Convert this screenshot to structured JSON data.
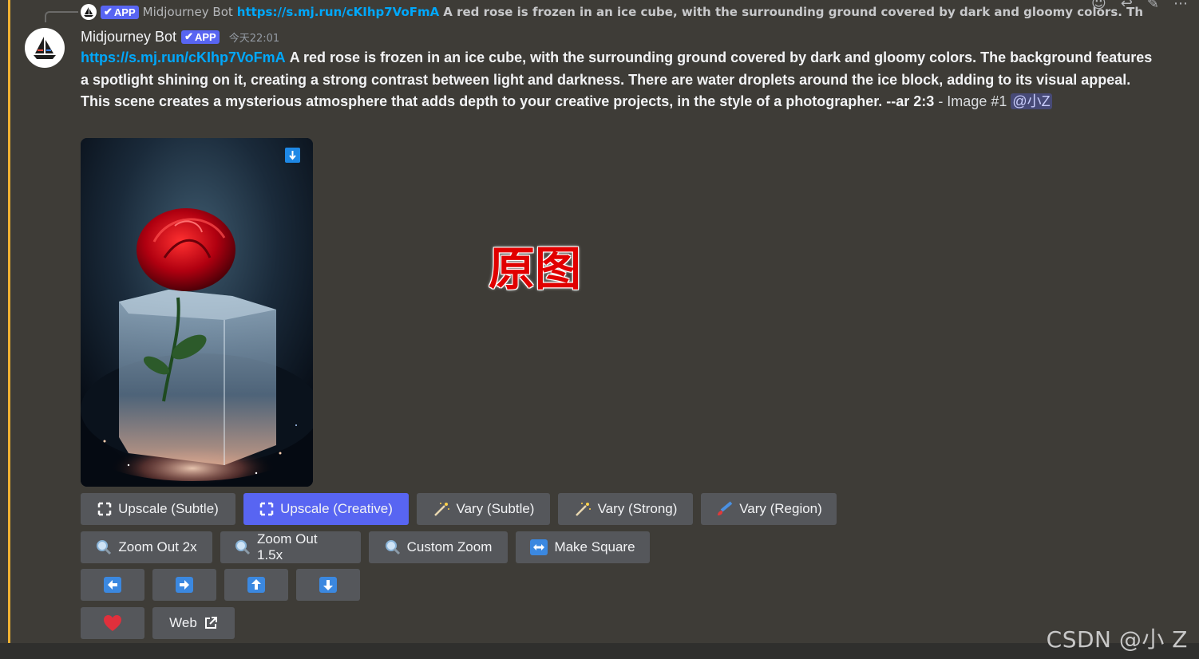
{
  "reply": {
    "badge": "APP",
    "name": "Midjourney Bot",
    "link": "https://s.mj.run/cKIhp7VoFmA",
    "text": "A red rose is frozen in an ice cube, with the surrounding ground covered by dark and gloomy colors. The background..."
  },
  "message": {
    "username": "Midjourney Bot",
    "badge": "APP",
    "timestamp": "今天22:01",
    "link": "https://s.mj.run/cKIhp7VoFmA",
    "prompt": "A red rose is frozen in an ice cube, with the surrounding ground covered by dark and gloomy colors. The background features a spotlight shining on it, creating a strong contrast between light and darkness. There are water droplets around the ice block, adding to its visual appeal. This scene creates a mysterious atmosphere that adds depth to your creative projects, in the style of a photographer. --ar 2:3",
    "suffix": " - Image #1 ",
    "mention": "@小Z"
  },
  "overlay_label": "原图",
  "buttons": {
    "row1": [
      {
        "label": "Upscale (Subtle)",
        "icon": "upscale-icon"
      },
      {
        "label": "Upscale (Creative)",
        "icon": "upscale-icon",
        "active": true
      },
      {
        "label": "Vary (Subtle)",
        "icon": "magic-wand-icon"
      },
      {
        "label": "Vary (Strong)",
        "icon": "magic-wand-icon"
      },
      {
        "label": "Vary (Region)",
        "icon": "paintbrush-icon"
      }
    ],
    "row2": [
      {
        "label": "Zoom Out 2x",
        "icon": "magnifier-icon"
      },
      {
        "label": "Zoom Out 1.5x",
        "icon": "magnifier-icon"
      },
      {
        "label": "Custom Zoom",
        "icon": "magnifier-icon"
      },
      {
        "label": "Make Square",
        "icon": "left-right-arrow-icon"
      }
    ],
    "row3": [
      {
        "icon": "arrow-left-icon"
      },
      {
        "icon": "arrow-right-icon"
      },
      {
        "icon": "arrow-up-icon"
      },
      {
        "icon": "arrow-down-icon"
      }
    ],
    "row4": [
      {
        "icon": "heart-icon"
      },
      {
        "label": "Web",
        "icon": "external-link-icon"
      }
    ]
  },
  "colors": {
    "accent": "#5865f2",
    "link": "#00a8fc",
    "highlight_bar": "#f0b232"
  },
  "watermark": "CSDN @小 Z"
}
